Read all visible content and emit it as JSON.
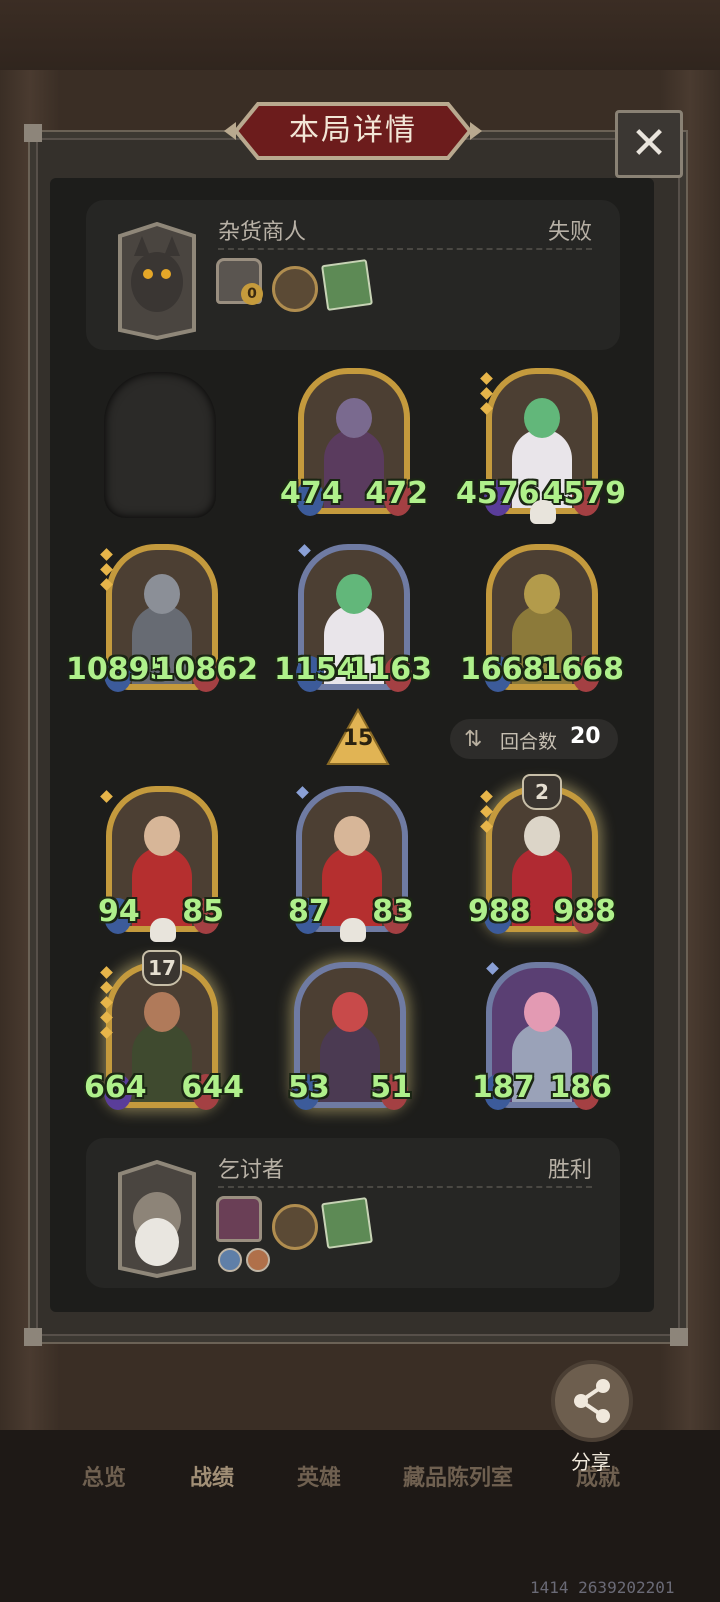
{
  "title": "本局详情",
  "close_symbol": "✕",
  "opponent": {
    "name": "杂货商人",
    "result": "失败",
    "badge": "0"
  },
  "player": {
    "name": "乞讨者",
    "result": "胜利"
  },
  "opponent_board": [
    {
      "attack": "474",
      "health": "472"
    },
    {
      "attack": "4576",
      "health": "4579"
    },
    {
      "attack": "10895",
      "health": "10862"
    },
    {
      "attack": "1154",
      "health": "1163"
    },
    {
      "attack": "1668",
      "health": "1668"
    }
  ],
  "player_board": [
    {
      "attack": "94",
      "health": "85"
    },
    {
      "attack": "87",
      "health": "83"
    },
    {
      "attack": "988",
      "health": "988",
      "level": "2"
    },
    {
      "attack": "664",
      "health": "644",
      "level": "17"
    },
    {
      "attack": "53",
      "health": "51"
    },
    {
      "attack": "187",
      "health": "186"
    }
  ],
  "turn_marker": "15",
  "rounds": {
    "label": "回合数",
    "value": "20"
  },
  "share_label": "分享",
  "nav": [
    "总览",
    "战绩",
    "英雄",
    "藏品陈列室",
    "成就"
  ],
  "uid": "1414 2639202201"
}
